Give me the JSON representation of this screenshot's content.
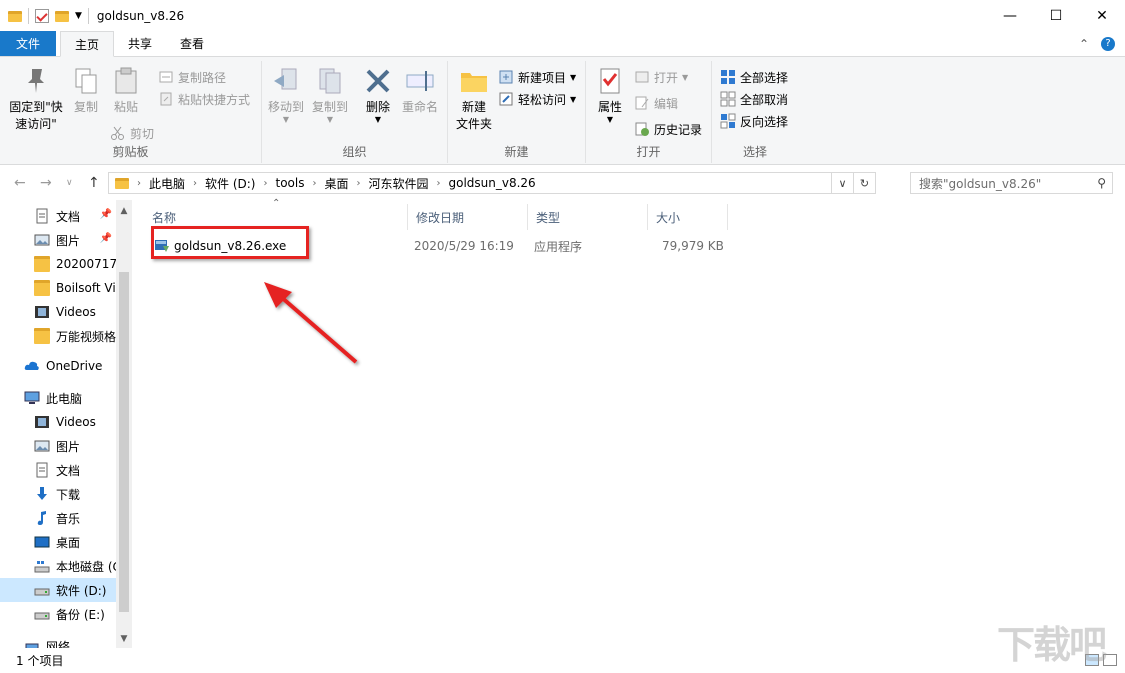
{
  "window": {
    "title": "goldsun_v8.26",
    "controls": {
      "minimize": "—",
      "maximize": "☐",
      "close": "✕"
    }
  },
  "tabs": [
    {
      "label": "文件"
    },
    {
      "label": "主页"
    },
    {
      "label": "共享"
    },
    {
      "label": "查看"
    }
  ],
  "ribbon": {
    "clipboard": {
      "label": "剪贴板",
      "pin_line1": "固定到\"快",
      "pin_line2": "速访问\"",
      "copy": "复制",
      "paste": "粘贴",
      "copy_path": "复制路径",
      "paste_shortcut": "粘贴快捷方式",
      "cut": "剪切"
    },
    "organize": {
      "label": "组织",
      "move_to": "移动到",
      "copy_to": "复制到",
      "delete": "删除",
      "rename": "重命名"
    },
    "new": {
      "label": "新建",
      "new_folder_line1": "新建",
      "new_folder_line2": "文件夹",
      "new_item": "新建项目",
      "easy_access": "轻松访问"
    },
    "open": {
      "label": "打开",
      "properties": "属性",
      "open": "打开",
      "edit": "编辑",
      "history": "历史记录"
    },
    "select": {
      "label": "选择",
      "select_all": "全部选择",
      "select_none": "全部取消",
      "invert": "反向选择"
    }
  },
  "address": {
    "crumbs": [
      "此电脑",
      "软件 (D:)",
      "tools",
      "桌面",
      "河东软件园",
      "goldsun_v8.26"
    ],
    "search_placeholder": "搜索\"goldsun_v8.26\""
  },
  "nav": {
    "quick": [
      {
        "label": "文档"
      },
      {
        "label": "图片"
      },
      {
        "label": "20200717"
      },
      {
        "label": "Boilsoft Vi"
      },
      {
        "label": "Videos"
      },
      {
        "label": "万能视频格"
      }
    ],
    "onedrive": "OneDrive",
    "thispc": "此电脑",
    "pc": [
      {
        "label": "Videos"
      },
      {
        "label": "图片"
      },
      {
        "label": "文档"
      },
      {
        "label": "下载"
      },
      {
        "label": "音乐"
      },
      {
        "label": "桌面"
      },
      {
        "label": "本地磁盘 (C"
      },
      {
        "label": "软件 (D:)"
      },
      {
        "label": "备份 (E:)"
      }
    ],
    "network": "网络"
  },
  "columns": {
    "name": "名称",
    "date": "修改日期",
    "type": "类型",
    "size": "大小"
  },
  "files": [
    {
      "name": "goldsun_v8.26.exe",
      "date": "2020/5/29 16:19",
      "type": "应用程序",
      "size": "79,979 KB"
    }
  ],
  "status": {
    "count": "1 个项目"
  },
  "watermark": "下载吧",
  "colors": {
    "accent": "#1979ca",
    "highlight": "#e52321",
    "selection": "#cce8ff"
  }
}
